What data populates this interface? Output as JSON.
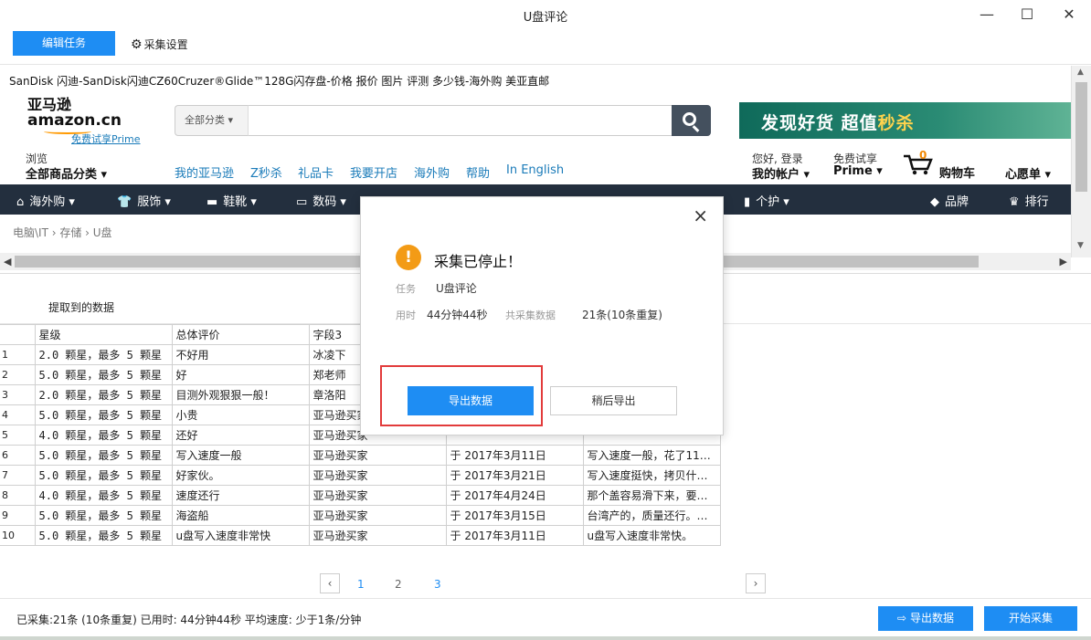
{
  "window": {
    "title": "U盘评论",
    "minimize": "—",
    "maximize": "☐",
    "close": "✕"
  },
  "toolbar": {
    "edit_task": "编辑任务",
    "settings": "采集设置"
  },
  "browser": {
    "page_title": "SanDisk 闪迪-SanDisk闪迪CZ60Cruzer®Glide™128G闪存盘-价格 报价 图片 评测 多少钱-海外购 美亚直邮",
    "logo_cn": "亚马逊",
    "logo_en": "amazon.cn",
    "prime_link": "免费试享Prime",
    "search_category": "全部分类 ▾",
    "banner_text_a": "发现好货 超值",
    "banner_text_b": "秒杀",
    "browse_small": "浏览",
    "browse_all": "全部商品分类 ▾",
    "nav_links": [
      "我的亚马逊",
      "Z秒杀",
      "礼品卡",
      "我要开店",
      "海外购",
      "帮助",
      "In English"
    ],
    "account_small": "您好, 登录",
    "account_big": "我的帐户 ▾",
    "trial_small": "免费试享",
    "trial_big": "Prime ▾",
    "cart_count": "0",
    "cart_label": "购物车",
    "wishlist": "心愿单 ▾",
    "dark_nav": [
      "海外购 ▾",
      "服饰 ▾",
      "鞋靴 ▾",
      "数码 ▾",
      "个护 ▾",
      "品牌",
      "排行"
    ],
    "breadcrumb": "电脑\\IT › 存储 › U盘"
  },
  "data_tab": {
    "label": "提取到的数据"
  },
  "table": {
    "headers": [
      "",
      "星级",
      "总体评价",
      "字段3",
      "",
      ""
    ],
    "rows": [
      [
        "1",
        "2.0 颗星，最多 5 颗星",
        "不好用",
        "冰凌下",
        "",
        ""
      ],
      [
        "2",
        "5.0 颗星，最多 5 颗星",
        "好",
        "郑老师",
        "",
        ""
      ],
      [
        "3",
        "2.0 颗星，最多 5 颗星",
        "目测外观狠狠一般！",
        "章洛阳",
        "",
        ""
      ],
      [
        "4",
        "5.0 颗星，最多 5 颗星",
        "小贵",
        "亚马逊买家",
        "",
        ""
      ],
      [
        "5",
        "4.0 颗星，最多 5 颗星",
        "还好",
        "亚马逊买家",
        "",
        ""
      ],
      [
        "6",
        "5.0 颗星，最多 5 颗星",
        "写入速度一般",
        "亚马逊买家",
        "于 2017年3月11日",
        "写入速度一般，花了11…"
      ],
      [
        "7",
        "5.0 颗星，最多 5 颗星",
        "好家伙。",
        "亚马逊买家",
        "于 2017年3月21日",
        "写入速度挺快，拷贝什…"
      ],
      [
        "8",
        "4.0 颗星，最多 5 颗星",
        "速度还行",
        "亚马逊买家",
        "于 2017年4月24日",
        "那个盖容易滑下来，要…"
      ],
      [
        "9",
        "5.0 颗星，最多 5 颗星",
        "海盗船",
        "亚马逊买家",
        "于 2017年3月15日",
        "台湾产的，质量还行。…"
      ],
      [
        "10",
        "5.0 颗星，最多 5 颗星",
        "u盘写入速度非常快",
        "亚马逊买家",
        "于 2017年3月11日",
        "u盘写入速度非常快。"
      ]
    ]
  },
  "pagination": {
    "prev": "‹",
    "pages": [
      "1",
      "2",
      "3"
    ],
    "next": "›"
  },
  "status": {
    "text": "已采集:21条 (10条重复)  已用时: 44分钟44秒 平均速度: 少于1条/分钟",
    "export": "导出数据",
    "start": "开始采集"
  },
  "modal": {
    "close": "×",
    "icon": "!",
    "title": "采集已停止！",
    "task_label": "任务",
    "task_value": "U盘评论",
    "time_label": "用时",
    "time_value": "44分钟44秒",
    "total_label": "共采集数据",
    "total_value": "21条(10条重复)",
    "export_btn": "导出数据",
    "later_btn": "稍后导出"
  }
}
